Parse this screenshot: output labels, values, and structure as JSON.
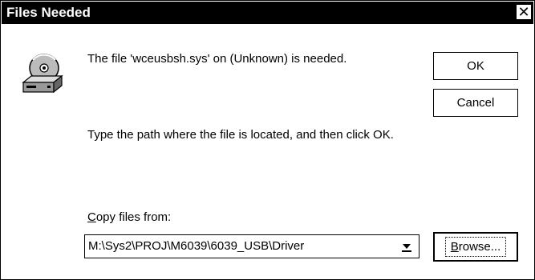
{
  "dialog": {
    "title": "Files Needed",
    "close_glyph": "✕",
    "message": "The file 'wceusbsh.sys' on (Unknown) is needed.",
    "instruction": "Type the path where the file is located, and then click OK.",
    "copy_label_accel": "C",
    "copy_label_rest": "opy files from:",
    "path_value": "M:\\Sys2\\PROJ\\M6039\\6039_USB\\Driver",
    "buttons": {
      "ok": "OK",
      "cancel": "Cancel",
      "browse_accel": "B",
      "browse_rest": "rowse..."
    },
    "icons": {
      "main": "disk-drive-cd-icon",
      "dropdown": "chevron-down-icon"
    }
  }
}
